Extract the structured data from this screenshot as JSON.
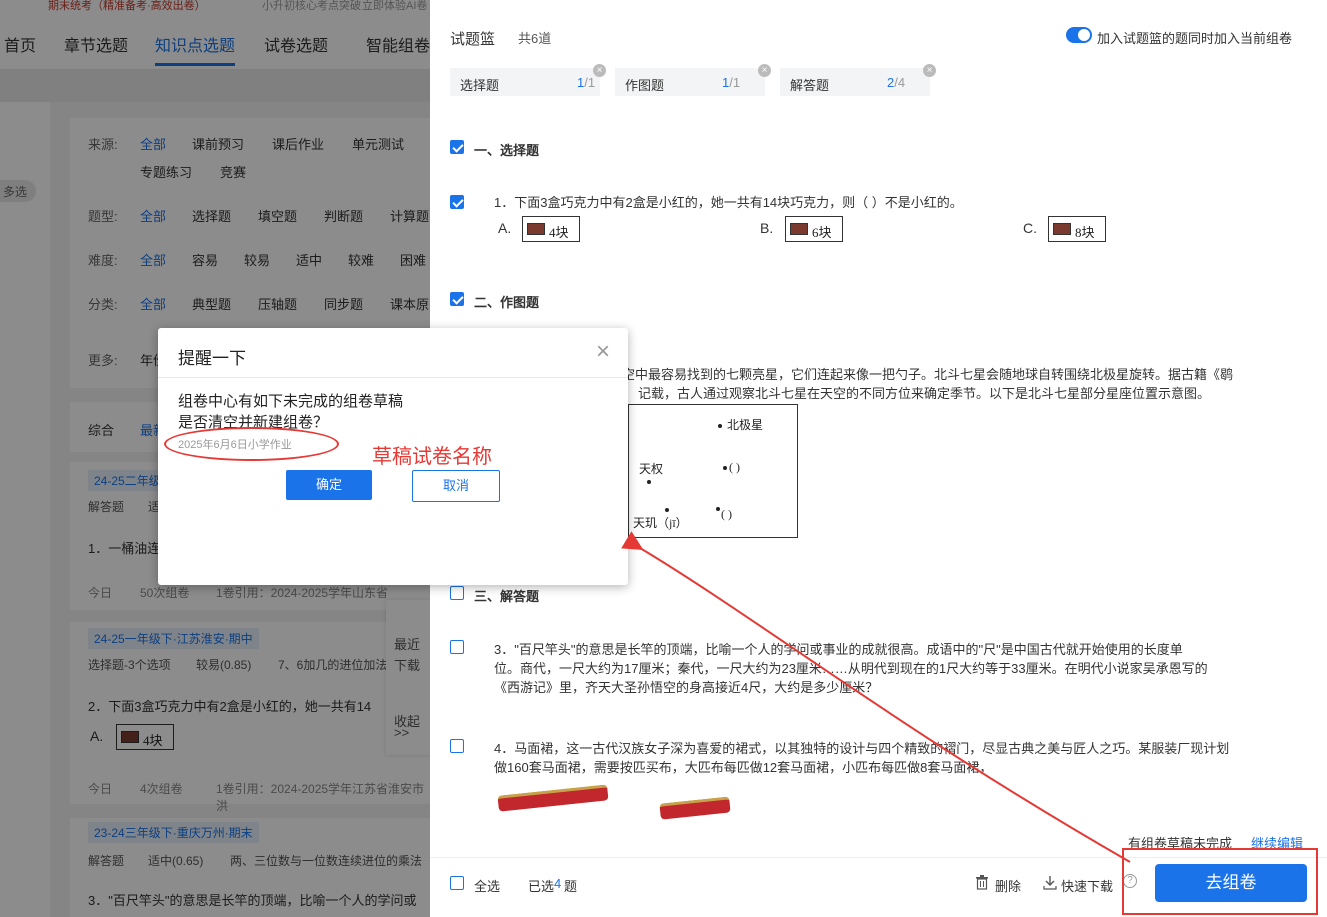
{
  "left_page": {
    "topstrip": {
      "promo1": "期末统考（精准备考·高效出卷）",
      "promo2": "小升初核心考点突破",
      "promo3": "立即体验AI卷"
    },
    "nav": [
      "首页",
      "章节选题",
      "知识点选题",
      "试卷选题",
      "智能组卷"
    ],
    "multi_select": "多选",
    "filters": {
      "source": {
        "label": "来源:",
        "options": [
          "全部",
          "课前预习",
          "课后作业",
          "单元测试",
          "专题练习",
          "竞赛"
        ]
      },
      "qtype": {
        "label": "题型:",
        "options": [
          "全部",
          "选择题",
          "填空题",
          "判断题",
          "计算题"
        ]
      },
      "difficulty": {
        "label": "难度:",
        "options": [
          "全部",
          "容易",
          "较易",
          "适中",
          "较难",
          "困难"
        ]
      },
      "category": {
        "label": "分类:",
        "options": [
          "全部",
          "典型题",
          "压轴题",
          "同步题",
          "课本原"
        ]
      },
      "more": {
        "label": "更多:",
        "value": "年份"
      }
    },
    "sort": {
      "label": "综合",
      "newest": "最新"
    },
    "cards": [
      {
        "tag": "24-25二年级",
        "meta1": "解答题",
        "meta2": "适",
        "question": "1．一桶油连",
        "today": "今日",
        "used": "50次组卷",
        "ref": "1卷引用：2024-2025学年山东省"
      },
      {
        "tag": "24-25一年级下·江苏淮安·期中",
        "meta1": "选择题-3个选项",
        "meta2": "较易(0.85)",
        "meta3": "7、6加几的进位加法",
        "question": "2．下面3盒巧克力中有2盒是小红的，她一共有14",
        "opt": "A.",
        "choc": "4块",
        "today": "今日",
        "used": "4次组卷",
        "ref": "1卷引用：2024-2025学年江苏省淮安市洪"
      },
      {
        "tag": "23-24三年级下·重庆万州·期末",
        "meta1": "解答题",
        "meta2": "适中(0.65)",
        "meta3": "两、三位数与一位数连续进位的乘法",
        "question": "3．\"百尺竿头\"的意思是长竿的顶端，比喻一个人的学问或"
      }
    ],
    "float_menu": {
      "recent": "最近",
      "download": "下载",
      "collapse": "收起",
      "arrows": ">>"
    }
  },
  "basket": {
    "title": "试题篮",
    "count": "共6道",
    "toggle_label": "加入试题篮的题同时加入当前组卷",
    "tabs": [
      {
        "name": "选择题",
        "sel": "1",
        "total": "/1"
      },
      {
        "name": "作图题",
        "sel": "1",
        "total": "/1"
      },
      {
        "name": "解答题",
        "sel": "2",
        "total": "/4"
      }
    ],
    "sections": {
      "s1": "一、选择题",
      "s2": "二、作图题",
      "s3": "三、解答题"
    },
    "q1": {
      "text": "1．下面3盒巧克力中有2盒是小红的，她一共有14块巧克力，则（      ）不是小红的。",
      "a": "A.",
      "a_val": "4块",
      "b": "B.",
      "b_val": "6块",
      "c": "C.",
      "c_val": "8块"
    },
    "q2": {
      "line1": "空中最容易找到的七颗亮星，它们连起来像一把勺子。北斗七星会随地球自转围绕北极星旋转。据古籍《鹖",
      "line2": "记载，古人通过观察北斗七星在天空的不同方位来确定季节。以下是北斗七星部分星座位置示意图。",
      "diagram": {
        "polaris": "北极星",
        "tianquan": "天权",
        "blank1": "(        )",
        "tianji": "天玑（jī）",
        "blank2": "(        )"
      }
    },
    "q3": {
      "line1": "3．\"百尺竿头\"的意思是长竿的顶端，比喻一个人的学问或事业的成就很高。成语中的\"尺\"是中国古代就开始使用的长度单",
      "line2": "位。商代，一尺大约为17厘米；秦代，一尺大约为23厘米……从明代到现在的1尺大约等于33厘米。在明代小说家吴承恩写的",
      "line3": "《西游记》里，齐天大圣孙悟空的身高接近4尺，大约是多少厘米？"
    },
    "q4": {
      "line1": "4．马面裙，这一古代汉族女子深为喜爱的裙式，以其独特的设计与四个精致的褶门，尽显古典之美与匠人之巧。某服装厂现计划",
      "line2": "做160套马面裙，需要按匹买布，大匹布每匹做12套马面裙，小匹布每匹做8套马面裙，"
    },
    "draft_note": "有组卷草稿未完成",
    "draft_link": "继续编辑",
    "bottom": {
      "select_all": "全选",
      "selected_prefix": "已选",
      "selected_count": "4",
      "selected_suffix": "题",
      "delete": "删除",
      "download": "快速下载",
      "help": "?",
      "go": "去组卷"
    }
  },
  "modal": {
    "title": "提醒一下",
    "close": "×",
    "msg1": "组卷中心有如下未完成的组卷草稿",
    "msg2": "是否清空并新建组卷？",
    "draft_name": "2025年6月6日小学作业",
    "ok": "确定",
    "cancel": "取消"
  },
  "annotation": {
    "label": "草稿试卷名称",
    "color": "#e53935"
  },
  "colors": {
    "accent": "#1a73e8",
    "annotation_red": "#e53935"
  }
}
